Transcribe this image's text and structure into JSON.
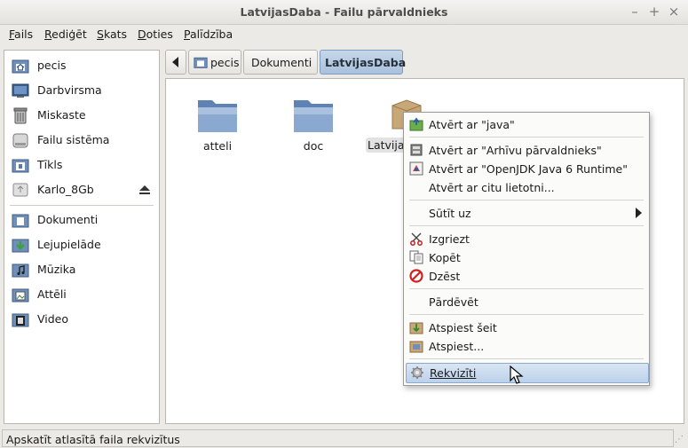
{
  "window": {
    "title": "LatvijasDaba - Failu pārvaldnieks"
  },
  "menubar": [
    {
      "label": "Fails",
      "u": "F",
      "rest": "ails"
    },
    {
      "label": "Rediģēt",
      "u": "R",
      "rest": "ediģēt"
    },
    {
      "label": "Skats",
      "u": "S",
      "rest": "kats"
    },
    {
      "label": "Doties",
      "u": "D",
      "rest": "oties"
    },
    {
      "label": "Palīdzība",
      "u": "P",
      "rest": "alīdzība"
    }
  ],
  "sidebar": {
    "places": [
      "pecis",
      "Darbvirsma",
      "Miskaste",
      "Failu sistēma",
      "Tīkls",
      "Karlo_8Gb"
    ],
    "bookmarks": [
      "Dokumenti",
      "Lejupielāde",
      "Mūzika",
      "Attēli",
      "Video"
    ]
  },
  "breadcrumb": {
    "items": [
      "pecis",
      "Dokumenti",
      "LatvijasDaba"
    ]
  },
  "files": [
    {
      "name": "atteli",
      "type": "folder"
    },
    {
      "name": "doc",
      "type": "folder"
    },
    {
      "name": "Latvijas",
      "type": "archive"
    }
  ],
  "context_menu": {
    "open_with_java": "Atvērt ar \"java\"",
    "open_with_archive": "Atvērt ar \"Arhīvu pārvaldnieks\"",
    "open_with_openjdk": "Atvērt ar \"OpenJDK Java 6 Runtime\"",
    "open_with_other": "Atvērt ar citu lietotni...",
    "send_to": "Sūtīt uz",
    "cut": "Izgriezt",
    "copy": "Kopēt",
    "delete": "Dzēst",
    "rename": "Pārdēvēt",
    "extract_here": "Atspiest šeit",
    "extract": "Atspiest...",
    "properties": "Rekvizīti"
  },
  "status": {
    "text": "Apskatīt atlasītā faila rekvizītus"
  },
  "colors": {
    "accent": "#a9c0dc",
    "folder": "#7a9cc6",
    "archive": "#c9a878"
  }
}
